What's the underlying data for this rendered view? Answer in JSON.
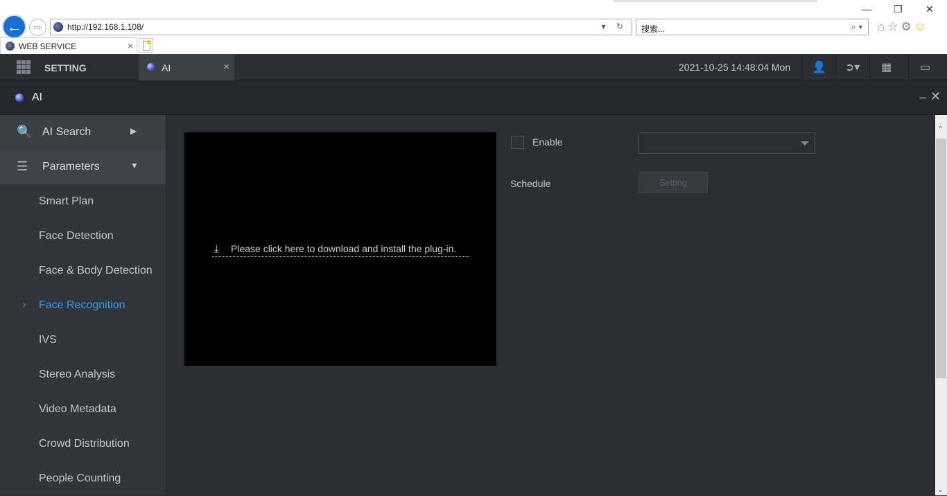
{
  "browser": {
    "url": "http://192.168.1.108/",
    "url_controls": "▾ ↻",
    "search_placeholder": "搜索...",
    "search_icon": "⌕ ▾",
    "tab_title": "WEB SERVICE",
    "tab_close": "×",
    "toolbar_icons": [
      "home-icon",
      "star-icon",
      "gear-icon",
      "smiley-icon"
    ],
    "window_controls": [
      "—",
      "❐",
      "✕"
    ]
  },
  "appbar": {
    "menu_label": "SETTING",
    "active_tab": "AI",
    "active_tab_close": "×",
    "datetime": "2021-10-25 14:48:04 Mon",
    "icons": [
      "user-icon",
      "logout-icon",
      "qrcode-icon",
      "monitor-icon"
    ]
  },
  "panel": {
    "title": "AI",
    "minimize": "–",
    "close": "✕"
  },
  "sidebar": {
    "ai_search": "AI Search",
    "ai_search_arrow": "▶",
    "parameters": "Parameters",
    "parameters_arrow": "▼",
    "items": [
      {
        "label": "Smart Plan"
      },
      {
        "label": "Face Detection"
      },
      {
        "label": "Face & Body Detection"
      },
      {
        "label": "Face Recognition",
        "active": true
      },
      {
        "label": "IVS"
      },
      {
        "label": "Stereo Analysis"
      },
      {
        "label": "Video Metadata"
      },
      {
        "label": "Crowd Distribution"
      },
      {
        "label": "People Counting"
      }
    ],
    "active_marker": "›"
  },
  "main": {
    "plugin_text": "Please click here to download and install the plug-in.",
    "enable_label": "Enable",
    "enable_checked": false,
    "channel_select_value": "",
    "schedule_label": "Schedule",
    "setting_button": "Setting"
  },
  "colors": {
    "accent": "#2f9bf0",
    "background": "#2a2d32",
    "sidebar": "#31353b"
  }
}
